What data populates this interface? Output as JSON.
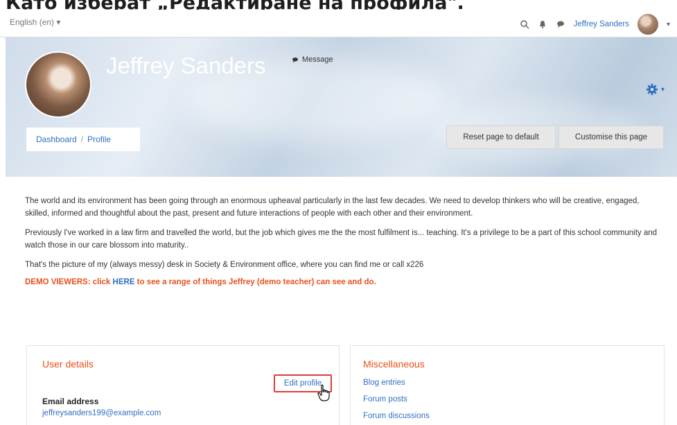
{
  "caption": "Като изберат „Редактиране на профила\".",
  "navbar": {
    "language": "English (en)",
    "user_name": "Jeffrey Sanders"
  },
  "hero": {
    "name": "Jeffrey Sanders",
    "message_label": "Message",
    "breadcrumb": [
      "Dashboard",
      "Profile"
    ],
    "reset_button": "Reset page to default",
    "customise_button": "Customise this page"
  },
  "bio": {
    "paragraphs": [
      "The world and its environment has been going through an enormous upheaval particularly in the last few decades. We need to develop thinkers who will be creative, engaged, skilled, informed and thoughtful about the past, present and future interactions of people with each other and their environment.",
      "Previously I've worked in a law firm and travelled the world,  but the job which gives me the the most fulfilment is... teaching. It's a privilege to be a part of this school community and watch those in our care blossom into maturity..",
      "That's the picture of my (always messy) desk in Society & Environment office, where you can find me or call x226"
    ],
    "demo_prefix": "DEMO VIEWERS: click ",
    "demo_link": "HERE",
    "demo_suffix": " to see a range of things Jeffrey (demo teacher) can see and do."
  },
  "user_details": {
    "title": "User details",
    "edit_profile": "Edit profile",
    "email_label": "Email address",
    "email_value": "jeffreysanders199@example.com"
  },
  "misc": {
    "title": "Miscellaneous",
    "links": [
      "Blog entries",
      "Forum posts",
      "Forum discussions"
    ]
  },
  "colors": {
    "link": "#2f6fc0",
    "accent_orange": "#e8501c",
    "highlight_red": "#e03a3a"
  },
  "icons": [
    "search-icon",
    "bell-icon",
    "chat-icon",
    "gear-icon",
    "hand-cursor-icon"
  ]
}
